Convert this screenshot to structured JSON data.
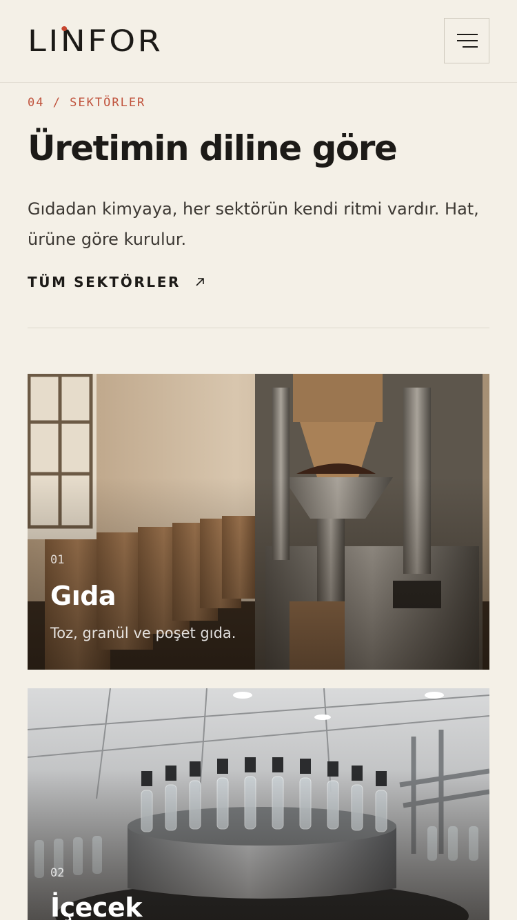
{
  "header": {
    "logo_text": "LINFOR",
    "menu_label": "menu"
  },
  "section": {
    "eyebrow": "04 / SEKTÖRLER",
    "title": "Üretimin diline göre",
    "lead": "Gıdadan kimyaya, her sektörün kendi ritmi vardır. Hat, ürüne göre kurulur.",
    "cta_label": "TÜM SEKTÖRLER"
  },
  "sectors": [
    {
      "number": "01",
      "name": "Gıda",
      "description": "Toz, granül ve poşet gıda."
    },
    {
      "number": "02",
      "name": "İçecek",
      "description": ""
    }
  ],
  "colors": {
    "background": "#f4f0e7",
    "accent": "#c0533d",
    "text": "#1c1a17"
  }
}
